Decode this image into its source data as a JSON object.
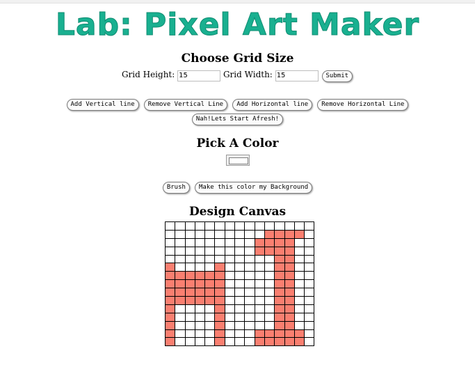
{
  "page": {
    "title": "Lab: Pixel Art Maker"
  },
  "grid_size": {
    "heading": "Choose Grid Size",
    "height_label": "Grid Height:",
    "height_value": "15",
    "width_label": "Grid Width:",
    "width_value": "15",
    "submit_label": "Submit"
  },
  "line_buttons": {
    "add_vertical": "Add Vertical line",
    "remove_vertical": "Remove Vertical Line",
    "add_horizontal": "Add Horizontal line",
    "remove_horizontal": "Remove Horizontal Line",
    "reset": "Nah!Lets Start Afresh!"
  },
  "color": {
    "heading": "Pick A Color",
    "value": "#ffffff",
    "brush_label": "Brush",
    "background_label": "Make this color my Background"
  },
  "canvas": {
    "heading": "Design Canvas",
    "rows": 15,
    "cols": 15,
    "paint_color": "#fa7f70",
    "painted": [
      [
        0,
        0,
        0,
        0,
        0,
        0,
        0,
        0,
        0,
        0,
        0,
        0,
        0,
        0,
        0
      ],
      [
        0,
        0,
        0,
        0,
        0,
        0,
        0,
        0,
        0,
        0,
        1,
        1,
        1,
        1,
        0
      ],
      [
        0,
        0,
        0,
        0,
        0,
        0,
        0,
        0,
        0,
        1,
        1,
        1,
        1,
        0,
        0
      ],
      [
        0,
        0,
        0,
        0,
        0,
        0,
        0,
        0,
        0,
        1,
        1,
        1,
        1,
        0,
        0
      ],
      [
        0,
        0,
        0,
        0,
        0,
        0,
        0,
        0,
        0,
        0,
        0,
        1,
        1,
        0,
        0
      ],
      [
        1,
        0,
        0,
        0,
        0,
        1,
        0,
        0,
        0,
        0,
        0,
        1,
        1,
        0,
        0
      ],
      [
        1,
        1,
        1,
        1,
        1,
        1,
        0,
        0,
        0,
        0,
        0,
        1,
        1,
        0,
        0
      ],
      [
        1,
        1,
        1,
        1,
        1,
        1,
        0,
        0,
        0,
        0,
        0,
        1,
        1,
        0,
        0
      ],
      [
        1,
        1,
        1,
        1,
        1,
        1,
        0,
        0,
        0,
        0,
        0,
        1,
        1,
        0,
        0
      ],
      [
        1,
        1,
        1,
        1,
        1,
        1,
        0,
        0,
        0,
        0,
        0,
        1,
        1,
        0,
        0
      ],
      [
        1,
        0,
        0,
        0,
        0,
        1,
        0,
        0,
        0,
        0,
        0,
        1,
        1,
        0,
        0
      ],
      [
        1,
        0,
        0,
        0,
        0,
        1,
        0,
        0,
        0,
        0,
        0,
        1,
        1,
        0,
        0
      ],
      [
        1,
        0,
        0,
        0,
        0,
        1,
        0,
        0,
        0,
        0,
        0,
        1,
        1,
        0,
        0
      ],
      [
        1,
        0,
        0,
        0,
        0,
        1,
        0,
        0,
        0,
        1,
        1,
        1,
        1,
        1,
        0
      ],
      [
        1,
        0,
        0,
        0,
        0,
        1,
        0,
        0,
        0,
        1,
        1,
        1,
        1,
        1,
        0
      ]
    ]
  }
}
